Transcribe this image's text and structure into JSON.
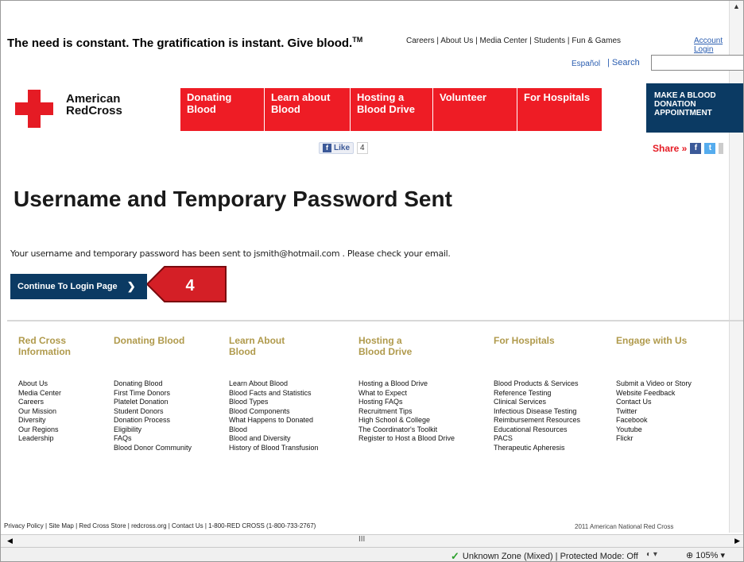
{
  "header": {
    "tagline": "The need is constant. The gratification is instant. Give blood.",
    "tagline_tm": "TM",
    "top_links": [
      "Careers",
      "About Us",
      "Media Center",
      "Students",
      "Fun & Games"
    ],
    "account_login": "Account Login",
    "espanol": "Español",
    "search": "Search",
    "search_value": ""
  },
  "logo": {
    "line1": "American",
    "line2": "RedCross"
  },
  "nav": [
    {
      "label": "Donating\nBlood"
    },
    {
      "label": "Learn about\nBlood"
    },
    {
      "label": "Hosting a\nBlood Drive"
    },
    {
      "label": "Volunteer"
    },
    {
      "label": "For Hospitals"
    }
  ],
  "appointment_button": "MAKE A BLOOD\nDONATION\nAPPOINTMENT",
  "social": {
    "like_label": "Like",
    "like_count": "4",
    "share_label": "Share »"
  },
  "main": {
    "title": "Username and Temporary Password Sent",
    "message": "Your username and temporary password has been sent to  jsmith@hotmail.com . Please check your email.",
    "continue_button": "Continue To Login Page",
    "callout_number": "4"
  },
  "footer": [
    {
      "heading": "Red Cross\nInformation",
      "items": [
        "About Us",
        "Media Center",
        "Careers",
        "Our Mission",
        "Diversity",
        "Our Regions",
        "Leadership"
      ]
    },
    {
      "heading": "Donating Blood",
      "items": [
        "Donating Blood",
        "First Time Donors",
        "Platelet Donation",
        "Student Donors",
        "Donation Process",
        "Eligibility",
        "FAQs",
        "Blood Donor Community"
      ]
    },
    {
      "heading": "Learn About\nBlood",
      "items": [
        "Learn About Blood",
        "Blood Facts and Statistics",
        "Blood Types",
        "Blood Components",
        "What Happens to Donated",
        "Blood",
        "Blood and Diversity",
        "History of Blood Transfusion"
      ]
    },
    {
      "heading": "Hosting a\nBlood Drive",
      "items": [
        "Hosting a Blood Drive",
        "What to Expect",
        "Hosting FAQs",
        "Recruitment Tips",
        "High School & College",
        "The Coordinator's Toolkit",
        "Register to Host a Blood Drive"
      ]
    },
    {
      "heading": "For Hospitals",
      "items": [
        "Blood Products & Services",
        "Reference Testing",
        "Clinical Services",
        "Infectious Disease Testing",
        "Reimbursement Resources",
        "Educational Resources",
        "PACS",
        "Therapeutic Apheresis"
      ]
    },
    {
      "heading": "Engage with Us",
      "items": [
        "Submit a Video or Story",
        "Website Feedback",
        "Contact Us",
        "Twitter",
        "Facebook",
        "Youtube",
        "Flickr"
      ]
    }
  ],
  "bottom_bar": {
    "links": "Privacy Policy  |  Site Map  |  Red Cross Store  |  redcross.org  |  Contact Us  |  1-800-RED CROSS (1-800-733-2767)",
    "copyright": "2011 American National Red Cross"
  },
  "statusbar": {
    "zone": "Unknown Zone (Mixed) | Protected Mode: Off",
    "zoom": "105%"
  }
}
